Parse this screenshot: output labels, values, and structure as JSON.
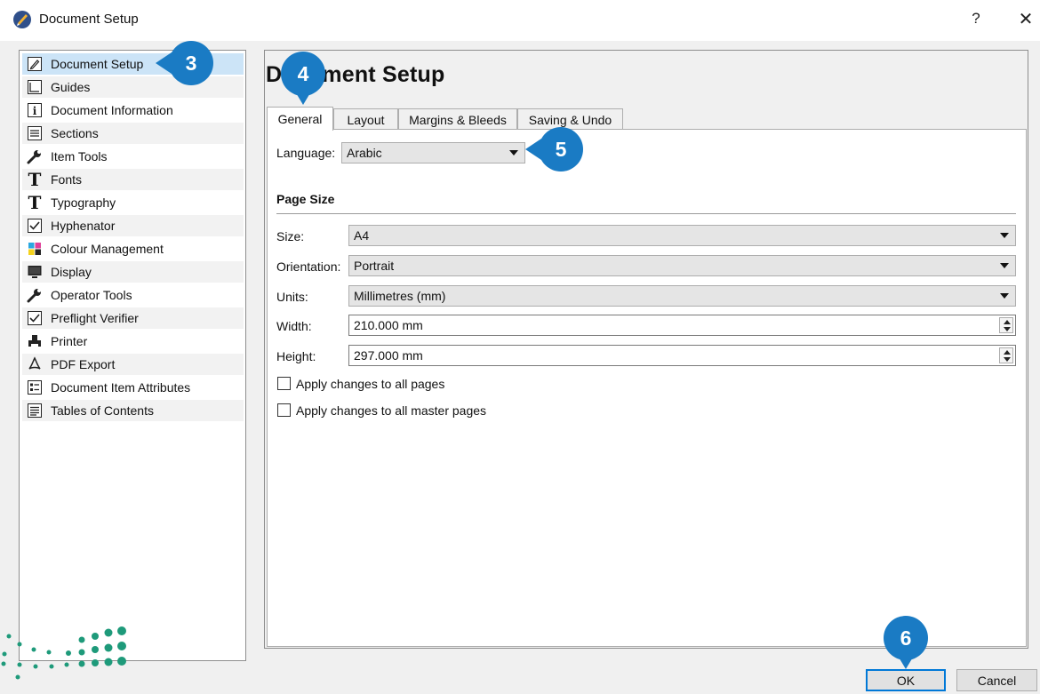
{
  "window": {
    "title": "Document Setup",
    "help_glyph": "?",
    "close_glyph": "✕"
  },
  "sidebar": {
    "items": [
      {
        "label": "Document Setup",
        "icon": "document-setup-icon"
      },
      {
        "label": "Guides",
        "icon": "guides-icon"
      },
      {
        "label": "Document Information",
        "icon": "info-icon"
      },
      {
        "label": "Sections",
        "icon": "sections-icon"
      },
      {
        "label": "Item Tools",
        "icon": "wrench-icon"
      },
      {
        "label": "Fonts",
        "icon": "font-icon"
      },
      {
        "label": "Typography",
        "icon": "typography-icon"
      },
      {
        "label": "Hyphenator",
        "icon": "checkbox-icon"
      },
      {
        "label": "Colour Management",
        "icon": "colour-management-icon"
      },
      {
        "label": "Display",
        "icon": "monitor-icon"
      },
      {
        "label": "Operator Tools",
        "icon": "wrench-icon"
      },
      {
        "label": "Preflight Verifier",
        "icon": "checkbox-icon"
      },
      {
        "label": "Printer",
        "icon": "printer-icon"
      },
      {
        "label": "PDF Export",
        "icon": "pdf-icon"
      },
      {
        "label": "Document Item Attributes",
        "icon": "attributes-icon"
      },
      {
        "label": "Tables of Contents",
        "icon": "toc-icon"
      }
    ],
    "selected_index": 0
  },
  "main": {
    "title": "Document Setup",
    "tabs": [
      {
        "label": "General"
      },
      {
        "label": "Layout"
      },
      {
        "label": "Margins & Bleeds"
      },
      {
        "label": "Saving & Undo"
      }
    ],
    "active_tab": 0,
    "language": {
      "label": "Language:",
      "value": "Arabic"
    },
    "page_size": {
      "title": "Page Size",
      "size": {
        "label": "Size:",
        "value": "A4"
      },
      "orientation": {
        "label": "Orientation:",
        "value": "Portrait"
      },
      "units": {
        "label": "Units:",
        "value": "Millimetres (mm)"
      },
      "width": {
        "label": "Width:",
        "value": "210.000 mm"
      },
      "height": {
        "label": "Height:",
        "value": "297.000 mm"
      },
      "apply_all_pages": {
        "label": "Apply changes to all pages",
        "checked": false
      },
      "apply_all_master": {
        "label": "Apply changes to all master pages",
        "checked": false
      }
    }
  },
  "footer": {
    "ok_label": "OK",
    "cancel_label": "Cancel"
  },
  "callouts": [
    "3",
    "4",
    "5",
    "6"
  ],
  "colors": {
    "callout": "#1a7bc4",
    "selection": "#cce4f7",
    "default_button_border": "#0078d7",
    "logo_green": "#1e9a7a"
  }
}
